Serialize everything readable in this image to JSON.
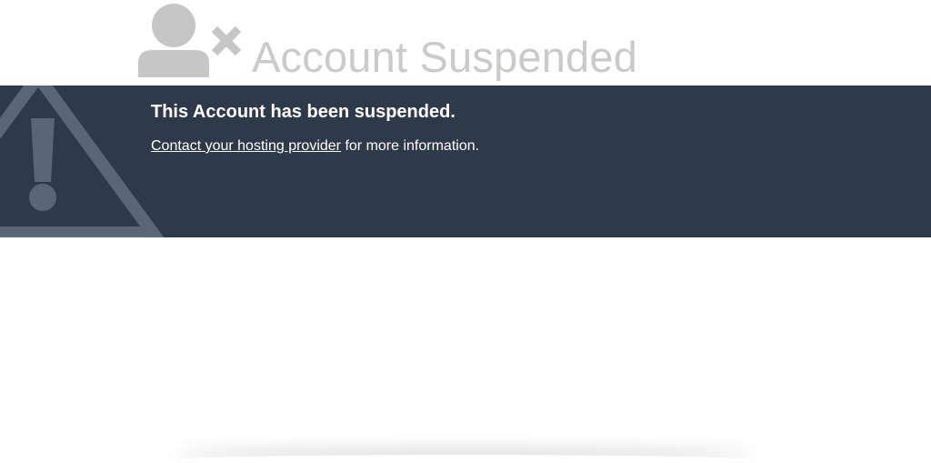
{
  "header": {
    "title": "Account Suspended",
    "icon": "user-remove-icon"
  },
  "banner": {
    "heading": "This Account has been suspended.",
    "link_text": "Contact your hosting provider",
    "info_suffix": " for more information.",
    "icon": "warning-icon"
  },
  "colors": {
    "banner_bg": "#2e3a4a",
    "title": "#cacaca",
    "icon_gray": "#c6c6c6",
    "warning_gray": "#5a6676"
  }
}
